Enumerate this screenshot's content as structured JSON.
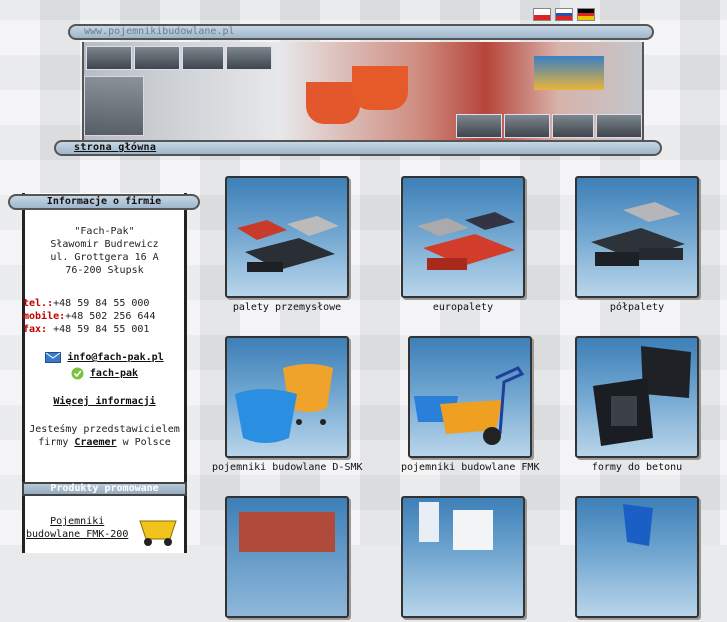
{
  "site": {
    "url": "www.pojemnikibudowlane.pl",
    "home_link": "strona główna"
  },
  "sidebar": {
    "title": "Informacje o firmie",
    "company_name": "\"Fach-Pak\"",
    "owner": "Sławomir Budrewicz",
    "street": "ul. Grottgera 16 A",
    "city": "76-200 Słupsk",
    "tel_label": "tel.:",
    "tel_value": "+48 59 84 55 000",
    "mobile_label": "mobile:",
    "mobile_value": "+48 502 256 644",
    "fax_label": "fax:",
    "fax_value": " +48 59 84 55 001",
    "email": "info@fach-pak.pl",
    "skype": "fach-pak",
    "more_link": "Więcej informacji",
    "rep_text_1": "Jesteśmy przedstawicielem",
    "rep_text_2a": "firmy ",
    "rep_brand": "Craemer",
    "rep_text_2b": " w Polsce",
    "promo_title": "Produkty promowane",
    "promo_item_1": "Pojemniki",
    "promo_item_2": "budowlane FMK-200"
  },
  "products": [
    {
      "label": "palety przemysłowe"
    },
    {
      "label": "europalety"
    },
    {
      "label": "półpalety"
    },
    {
      "label": "pojemniki budowlane D-SMK"
    },
    {
      "label": "pojemniki budowlane FMK"
    },
    {
      "label": "formy do betonu"
    },
    {
      "label": ""
    },
    {
      "label": ""
    },
    {
      "label": ""
    }
  ],
  "colors": {
    "accent_red": "#c00000",
    "bar_blue": "#a9bfd2"
  },
  "icons": [
    "flag-pl-icon",
    "flag-ru-icon",
    "flag-de-icon",
    "email-icon",
    "skype-icon"
  ]
}
